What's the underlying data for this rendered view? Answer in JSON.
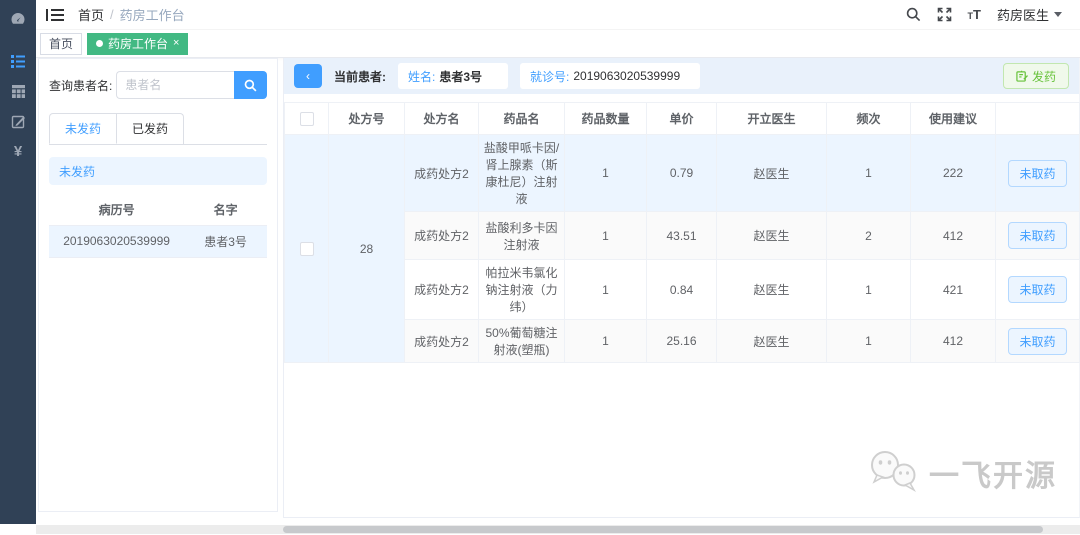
{
  "colors": {
    "accent_blue": "#409eff",
    "tag_green": "#42b983",
    "success_green": "#67c23a",
    "sidebar_bg": "#304156",
    "row_highlight": "#ecf5ff"
  },
  "header": {
    "breadcrumb_home": "首页",
    "breadcrumb_sep": "/",
    "breadcrumb_current": "药房工作台",
    "user_name": "药房医生"
  },
  "tags": {
    "home": "首页",
    "active": "药房工作台",
    "close": "×"
  },
  "left_panel": {
    "search_label": "查询患者名:",
    "search_placeholder": "患者名",
    "tab_pending": "未发药",
    "tab_dispensed": "已发药",
    "alert_text": "未发药",
    "col_record_no": "病历号",
    "col_name": "名字",
    "patient": {
      "record_no": "2019063020539999",
      "name": "患者3号"
    }
  },
  "toolbar": {
    "back_label": "‹",
    "current_patient_label": "当前患者:",
    "name_label": "姓名:",
    "name_value": "患者3号",
    "visit_label": "就诊号:",
    "visit_value": "2019063020539999",
    "dispense_label": "发药"
  },
  "table": {
    "headers": {
      "rx_no": "处方号",
      "rx_name": "处方名",
      "drug_name": "药品名",
      "qty": "药品数量",
      "unit_price": "单价",
      "doctor": "开立医生",
      "frequency": "频次",
      "advice": "使用建议"
    },
    "prescription_no": "28",
    "rows": [
      {
        "rx_name": "成药处方2",
        "drug": "盐酸甲哌卡因/肾上腺素（斯康杜尼）注射液",
        "qty": "1",
        "price": "0.79",
        "doctor": "赵医生",
        "freq": "1",
        "advice": "222",
        "status": "未取药"
      },
      {
        "rx_name": "成药处方2",
        "drug": "盐酸利多卡因注射液",
        "qty": "1",
        "price": "43.51",
        "doctor": "赵医生",
        "freq": "2",
        "advice": "412",
        "status": "未取药"
      },
      {
        "rx_name": "成药处方2",
        "drug": "帕拉米韦氯化钠注射液（力纬）",
        "qty": "1",
        "price": "0.84",
        "doctor": "赵医生",
        "freq": "1",
        "advice": "421",
        "status": "未取药"
      },
      {
        "rx_name": "成药处方2",
        "drug": "50%葡萄糖注射液(塑瓶)",
        "qty": "1",
        "price": "25.16",
        "doctor": "赵医生",
        "freq": "1",
        "advice": "412",
        "status": "未取药"
      }
    ]
  },
  "watermark": {
    "text": "一飞开源"
  }
}
